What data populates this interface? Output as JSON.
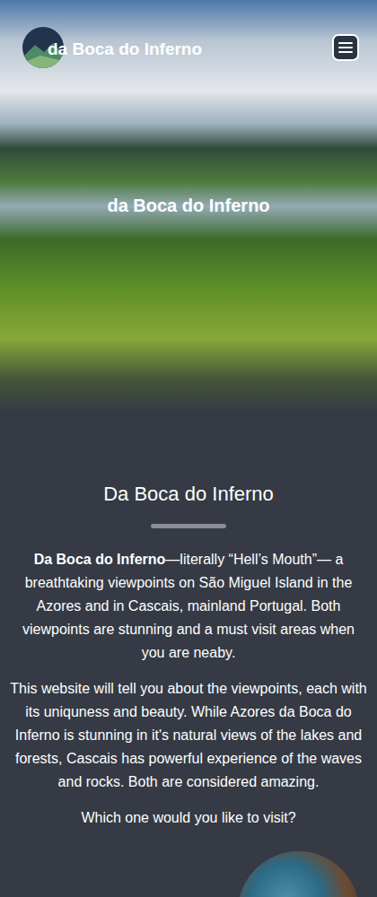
{
  "header": {
    "logo_text": "da Boca do Inferno"
  },
  "hero": {
    "title": "da Boca do Inferno"
  },
  "intro": {
    "heading": "Da Boca do Inferno",
    "lead_bold": "Da Boca do Inferno",
    "lead_rest": "—literally “Hell’s Mouth”— a breathtaking viewpoints on São Miguel Island in the Azores and in Cascais, mainland Portugal. Both viewpoints are stunning and a must visit areas when you are neaby.",
    "paragraphs": [
      "This website will tell you about the viewpoints, each with its uniquness and beauty. While Azores da Boca do Inferno is stunning in it's natural views of the lakes and forests, Cascais has powerful experience of the waves and rocks. Both are considered amazing.",
      "Which one would you like to visit?"
    ]
  }
}
